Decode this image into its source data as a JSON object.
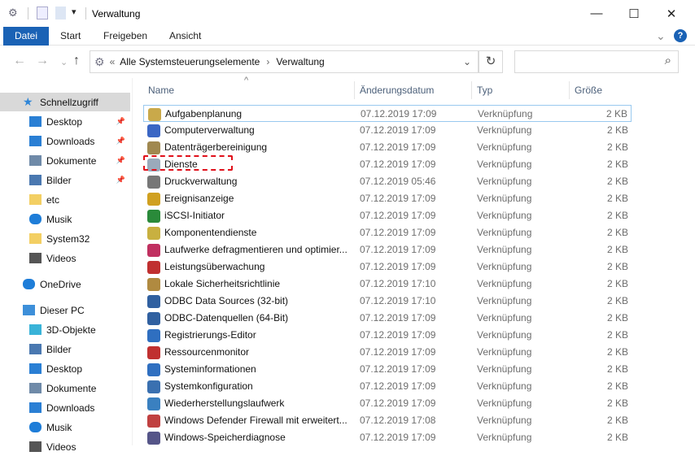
{
  "window": {
    "title": "Verwaltung",
    "minimize": "—",
    "maximize": "☐",
    "close": "✕"
  },
  "ribbon": {
    "tabs": [
      "Datei",
      "Start",
      "Freigeben",
      "Ansicht"
    ],
    "help": "?",
    "expand": "⌄"
  },
  "address": {
    "back": "←",
    "forward": "→",
    "recent": "⌄",
    "up": "↑",
    "chevrons": "«",
    "path": [
      "Alle Systemsteuerungselemente",
      "Verwaltung"
    ],
    "separator": "›",
    "dropdown": "⌄",
    "refresh": "↻",
    "search_icon": "⌕"
  },
  "columns": {
    "name": "Name",
    "date": "Änderungsdatum",
    "type": "Typ",
    "size": "Größe",
    "sort": "^"
  },
  "sidebar": [
    {
      "label": "Schnellzugriff",
      "icon": "star",
      "color": "#2f86d8",
      "selected": true
    },
    {
      "label": "Desktop",
      "icon": "desktop",
      "color": "#2a7fd4",
      "pin": true
    },
    {
      "label": "Downloads",
      "icon": "download",
      "color": "#2a7fd4",
      "pin": true
    },
    {
      "label": "Dokumente",
      "icon": "document",
      "color": "#6f8aa8",
      "pin": true
    },
    {
      "label": "Bilder",
      "icon": "pictures",
      "color": "#4a78b0",
      "pin": true
    },
    {
      "label": "etc",
      "icon": "folder",
      "color": "#f3cf63"
    },
    {
      "label": "Musik",
      "icon": "music",
      "color": "#1e7dd8"
    },
    {
      "label": "System32",
      "icon": "folder",
      "color": "#f3cf63"
    },
    {
      "label": "Videos",
      "icon": "video",
      "color": "#555"
    },
    {
      "label": "OneDrive",
      "icon": "cloud",
      "color": "#1e7dd8",
      "gap": true
    },
    {
      "label": "Dieser PC",
      "icon": "pc",
      "color": "#3d8fd9",
      "gap": true
    },
    {
      "label": "3D-Objekte",
      "icon": "cube",
      "color": "#39b3d8"
    },
    {
      "label": "Bilder",
      "icon": "pictures",
      "color": "#4a78b0"
    },
    {
      "label": "Desktop",
      "icon": "desktop",
      "color": "#2a7fd4"
    },
    {
      "label": "Dokumente",
      "icon": "document",
      "color": "#6f8aa8"
    },
    {
      "label": "Downloads",
      "icon": "download",
      "color": "#2a7fd4"
    },
    {
      "label": "Musik",
      "icon": "music",
      "color": "#1e7dd8"
    },
    {
      "label": "Videos",
      "icon": "video",
      "color": "#555"
    }
  ],
  "files": [
    {
      "name": "Aufgabenplanung",
      "date": "07.12.2019 17:09",
      "type": "Verknüpfung",
      "size": "2 KB",
      "color": "#c9a94a"
    },
    {
      "name": "Computerverwaltung",
      "date": "07.12.2019 17:09",
      "type": "Verknüpfung",
      "size": "2 KB",
      "color": "#3a66c4"
    },
    {
      "name": "Datenträgerbereinigung",
      "date": "07.12.2019 17:09",
      "type": "Verknüpfung",
      "size": "2 KB",
      "color": "#a08850"
    },
    {
      "name": "Dienste",
      "date": "07.12.2019 17:09",
      "type": "Verknüpfung",
      "size": "2 KB",
      "color": "#9aaabb"
    },
    {
      "name": "Druckverwaltung",
      "date": "07.12.2019 05:46",
      "type": "Verknüpfung",
      "size": "2 KB",
      "color": "#777"
    },
    {
      "name": "Ereignisanzeige",
      "date": "07.12.2019 17:09",
      "type": "Verknüpfung",
      "size": "2 KB",
      "color": "#d0a020"
    },
    {
      "name": "iSCSI-Initiator",
      "date": "07.12.2019 17:09",
      "type": "Verknüpfung",
      "size": "2 KB",
      "color": "#2a8a3a"
    },
    {
      "name": "Komponentendienste",
      "date": "07.12.2019 17:09",
      "type": "Verknüpfung",
      "size": "2 KB",
      "color": "#c8b040"
    },
    {
      "name": "Laufwerke defragmentieren und optimier...",
      "date": "07.12.2019 17:09",
      "type": "Verknüpfung",
      "size": "2 KB",
      "color": "#c03060"
    },
    {
      "name": "Leistungsüberwachung",
      "date": "07.12.2019 17:09",
      "type": "Verknüpfung",
      "size": "2 KB",
      "color": "#c03030"
    },
    {
      "name": "Lokale Sicherheitsrichtlinie",
      "date": "07.12.2019 17:10",
      "type": "Verknüpfung",
      "size": "2 KB",
      "color": "#b08a40"
    },
    {
      "name": "ODBC Data Sources (32-bit)",
      "date": "07.12.2019 17:10",
      "type": "Verknüpfung",
      "size": "2 KB",
      "color": "#3060a0"
    },
    {
      "name": "ODBC-Datenquellen (64-Bit)",
      "date": "07.12.2019 17:09",
      "type": "Verknüpfung",
      "size": "2 KB",
      "color": "#3060a0"
    },
    {
      "name": "Registrierungs-Editor",
      "date": "07.12.2019 17:09",
      "type": "Verknüpfung",
      "size": "2 KB",
      "color": "#2f6fc0"
    },
    {
      "name": "Ressourcenmonitor",
      "date": "07.12.2019 17:09",
      "type": "Verknüpfung",
      "size": "2 KB",
      "color": "#c03030"
    },
    {
      "name": "Systeminformationen",
      "date": "07.12.2019 17:09",
      "type": "Verknüpfung",
      "size": "2 KB",
      "color": "#2f6fc0"
    },
    {
      "name": "Systemkonfiguration",
      "date": "07.12.2019 17:09",
      "type": "Verknüpfung",
      "size": "2 KB",
      "color": "#3a70b0"
    },
    {
      "name": "Wiederherstellungslaufwerk",
      "date": "07.12.2019 17:09",
      "type": "Verknüpfung",
      "size": "2 KB",
      "color": "#3a80c0"
    },
    {
      "name": "Windows Defender Firewall mit erweitert...",
      "date": "07.12.2019 17:08",
      "type": "Verknüpfung",
      "size": "2 KB",
      "color": "#c04040"
    },
    {
      "name": "Windows-Speicherdiagnose",
      "date": "07.12.2019 17:09",
      "type": "Verknüpfung",
      "size": "2 KB",
      "color": "#558"
    }
  ]
}
